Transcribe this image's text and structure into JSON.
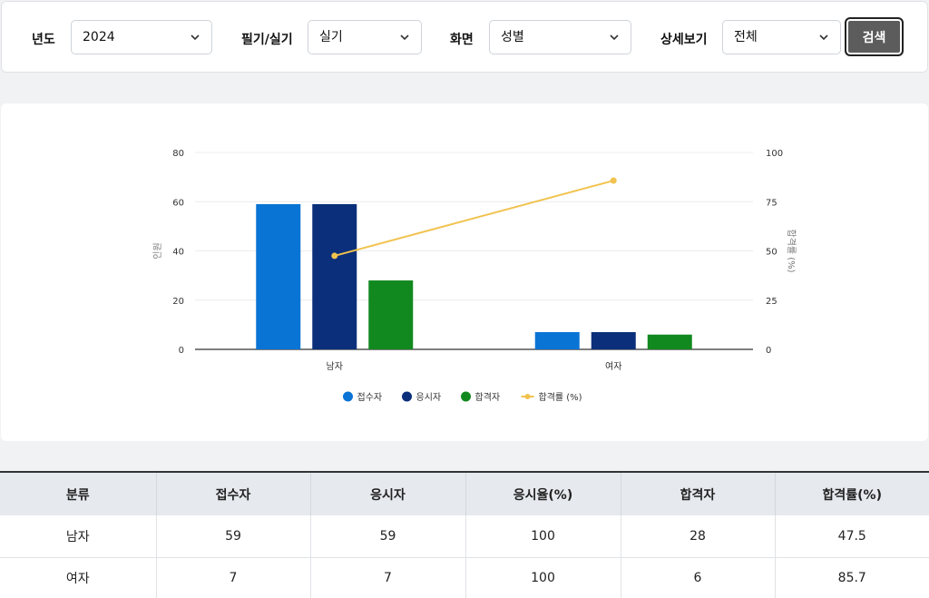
{
  "filters": {
    "year": {
      "label": "년도",
      "value": "2024"
    },
    "exam_type": {
      "label": "필기/실기",
      "value": "실기"
    },
    "view": {
      "label": "화면",
      "value": "성별"
    },
    "detail": {
      "label": "상세보기",
      "value": "전체"
    },
    "search_label": "검색"
  },
  "chart_data": {
    "type": "bar",
    "categories": [
      "남자",
      "여자"
    ],
    "series": [
      {
        "name": "접수자",
        "type": "bar",
        "axis": "left",
        "color": "#0a74d4",
        "values": [
          59,
          7
        ]
      },
      {
        "name": "응시자",
        "type": "bar",
        "axis": "left",
        "color": "#0b2f7a",
        "values": [
          59,
          7
        ]
      },
      {
        "name": "합격자",
        "type": "bar",
        "axis": "left",
        "color": "#12891f",
        "values": [
          28,
          6
        ]
      },
      {
        "name": "합격률 (%)",
        "type": "line",
        "axis": "right",
        "color": "#f1c24e",
        "values": [
          47.5,
          85.7
        ]
      }
    ],
    "ylabel": "인원",
    "y2label": "합격률 (%)",
    "ylim": [
      0,
      80
    ],
    "y2lim": [
      0,
      100
    ],
    "yticks": [
      "0",
      "20",
      "40",
      "60",
      "80"
    ],
    "y2ticks": [
      "0",
      "25",
      "50",
      "75",
      "100"
    ],
    "grid": true,
    "legend": "bottom"
  },
  "table": {
    "headers": [
      "분류",
      "접수자",
      "응시자",
      "응시율(%)",
      "합격자",
      "합격률(%)"
    ],
    "rows": [
      [
        "남자",
        "59",
        "59",
        "100",
        "28",
        "47.5"
      ],
      [
        "여자",
        "7",
        "7",
        "100",
        "6",
        "85.7"
      ]
    ]
  }
}
